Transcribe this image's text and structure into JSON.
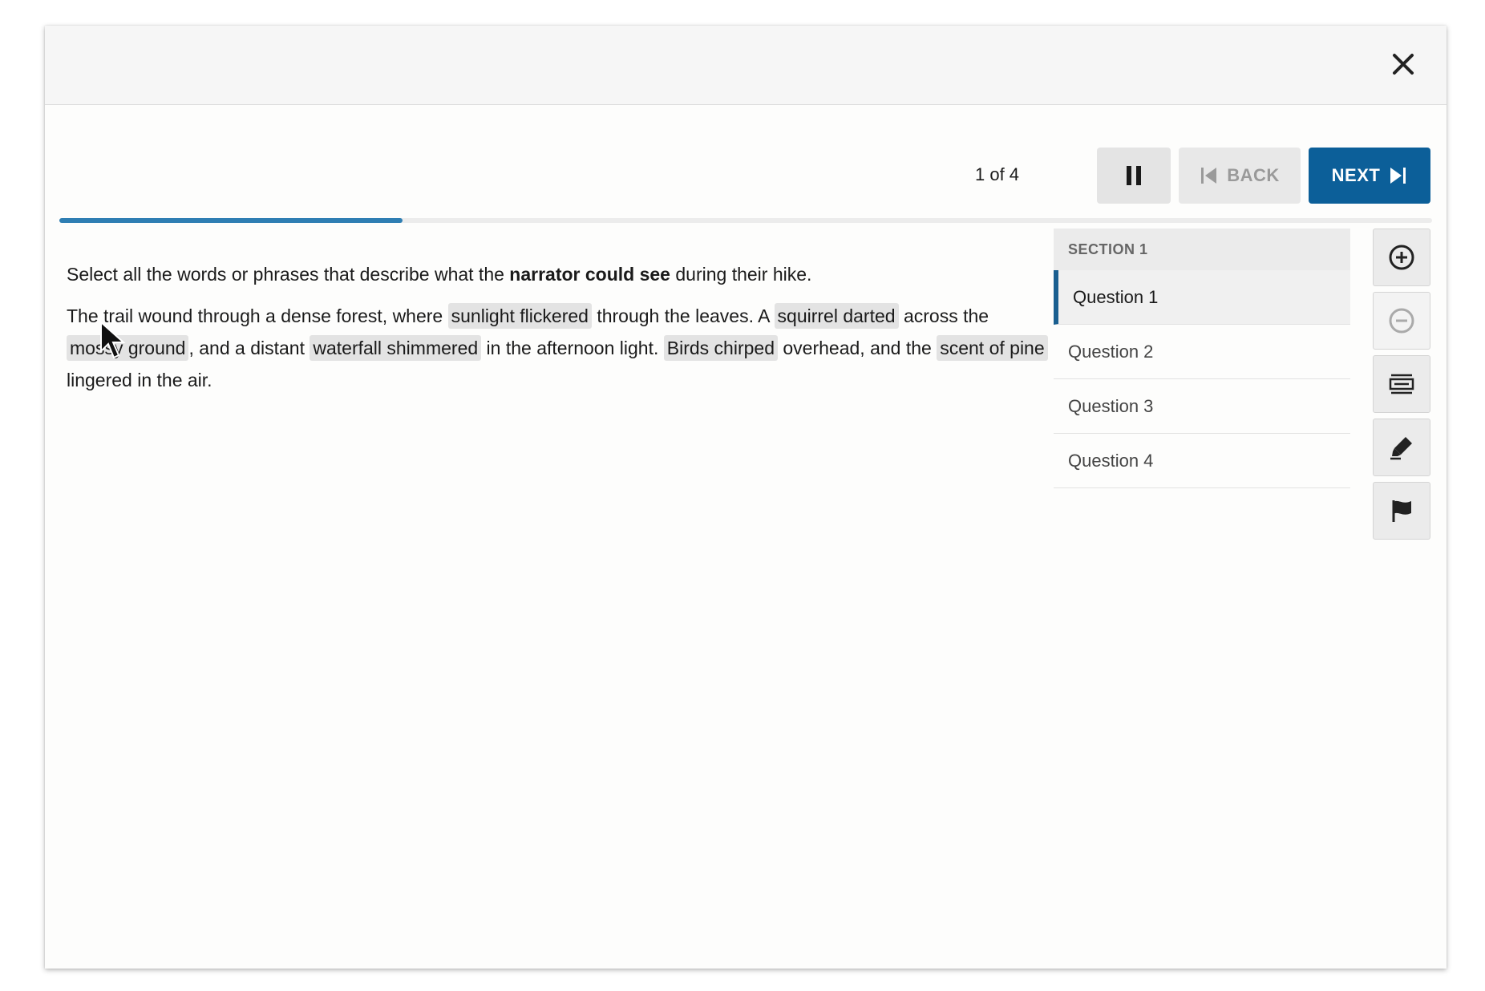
{
  "toolbar": {
    "counter": "1 of 4",
    "back_label": "BACK",
    "next_label": "NEXT",
    "progress_fraction": 0.25
  },
  "question": {
    "prompt_before": "Select all the words or phrases that describe what the ",
    "prompt_bold": "narrator could see",
    "prompt_after": " during their hike.",
    "passage": {
      "t1": "The trail wound through a dense forest, where ",
      "o1": "sunlight flickered",
      "t2": " through the leaves. A ",
      "o2": "squirrel darted",
      "t3": " across the ",
      "o3": "mossy ground",
      "t4": ", and a distant ",
      "o4": "waterfall shimmered",
      "t5": " in the afternoon light. ",
      "o5": "Birds chirped",
      "t6": " overhead, and the ",
      "o6": "scent of pine",
      "t7": " lingered in the air."
    }
  },
  "sidebar": {
    "section_label": "SECTION 1",
    "items": [
      {
        "label": "Question 1"
      },
      {
        "label": "Question 2"
      },
      {
        "label": "Question 3"
      },
      {
        "label": "Question 4"
      }
    ]
  },
  "icons": {
    "close": "close-icon",
    "pause": "pause-icon",
    "back": "skip-back-icon",
    "next": "skip-next-icon",
    "zoom_in": "zoom-in-icon",
    "zoom_out": "zoom-out-icon",
    "line_reader": "line-reader-icon",
    "highlighter": "highlighter-icon",
    "flag": "flag-icon"
  },
  "colors": {
    "accent": "#0c5f99",
    "progress": "#2e7eb3",
    "option_bg": "#e3e3e3"
  }
}
